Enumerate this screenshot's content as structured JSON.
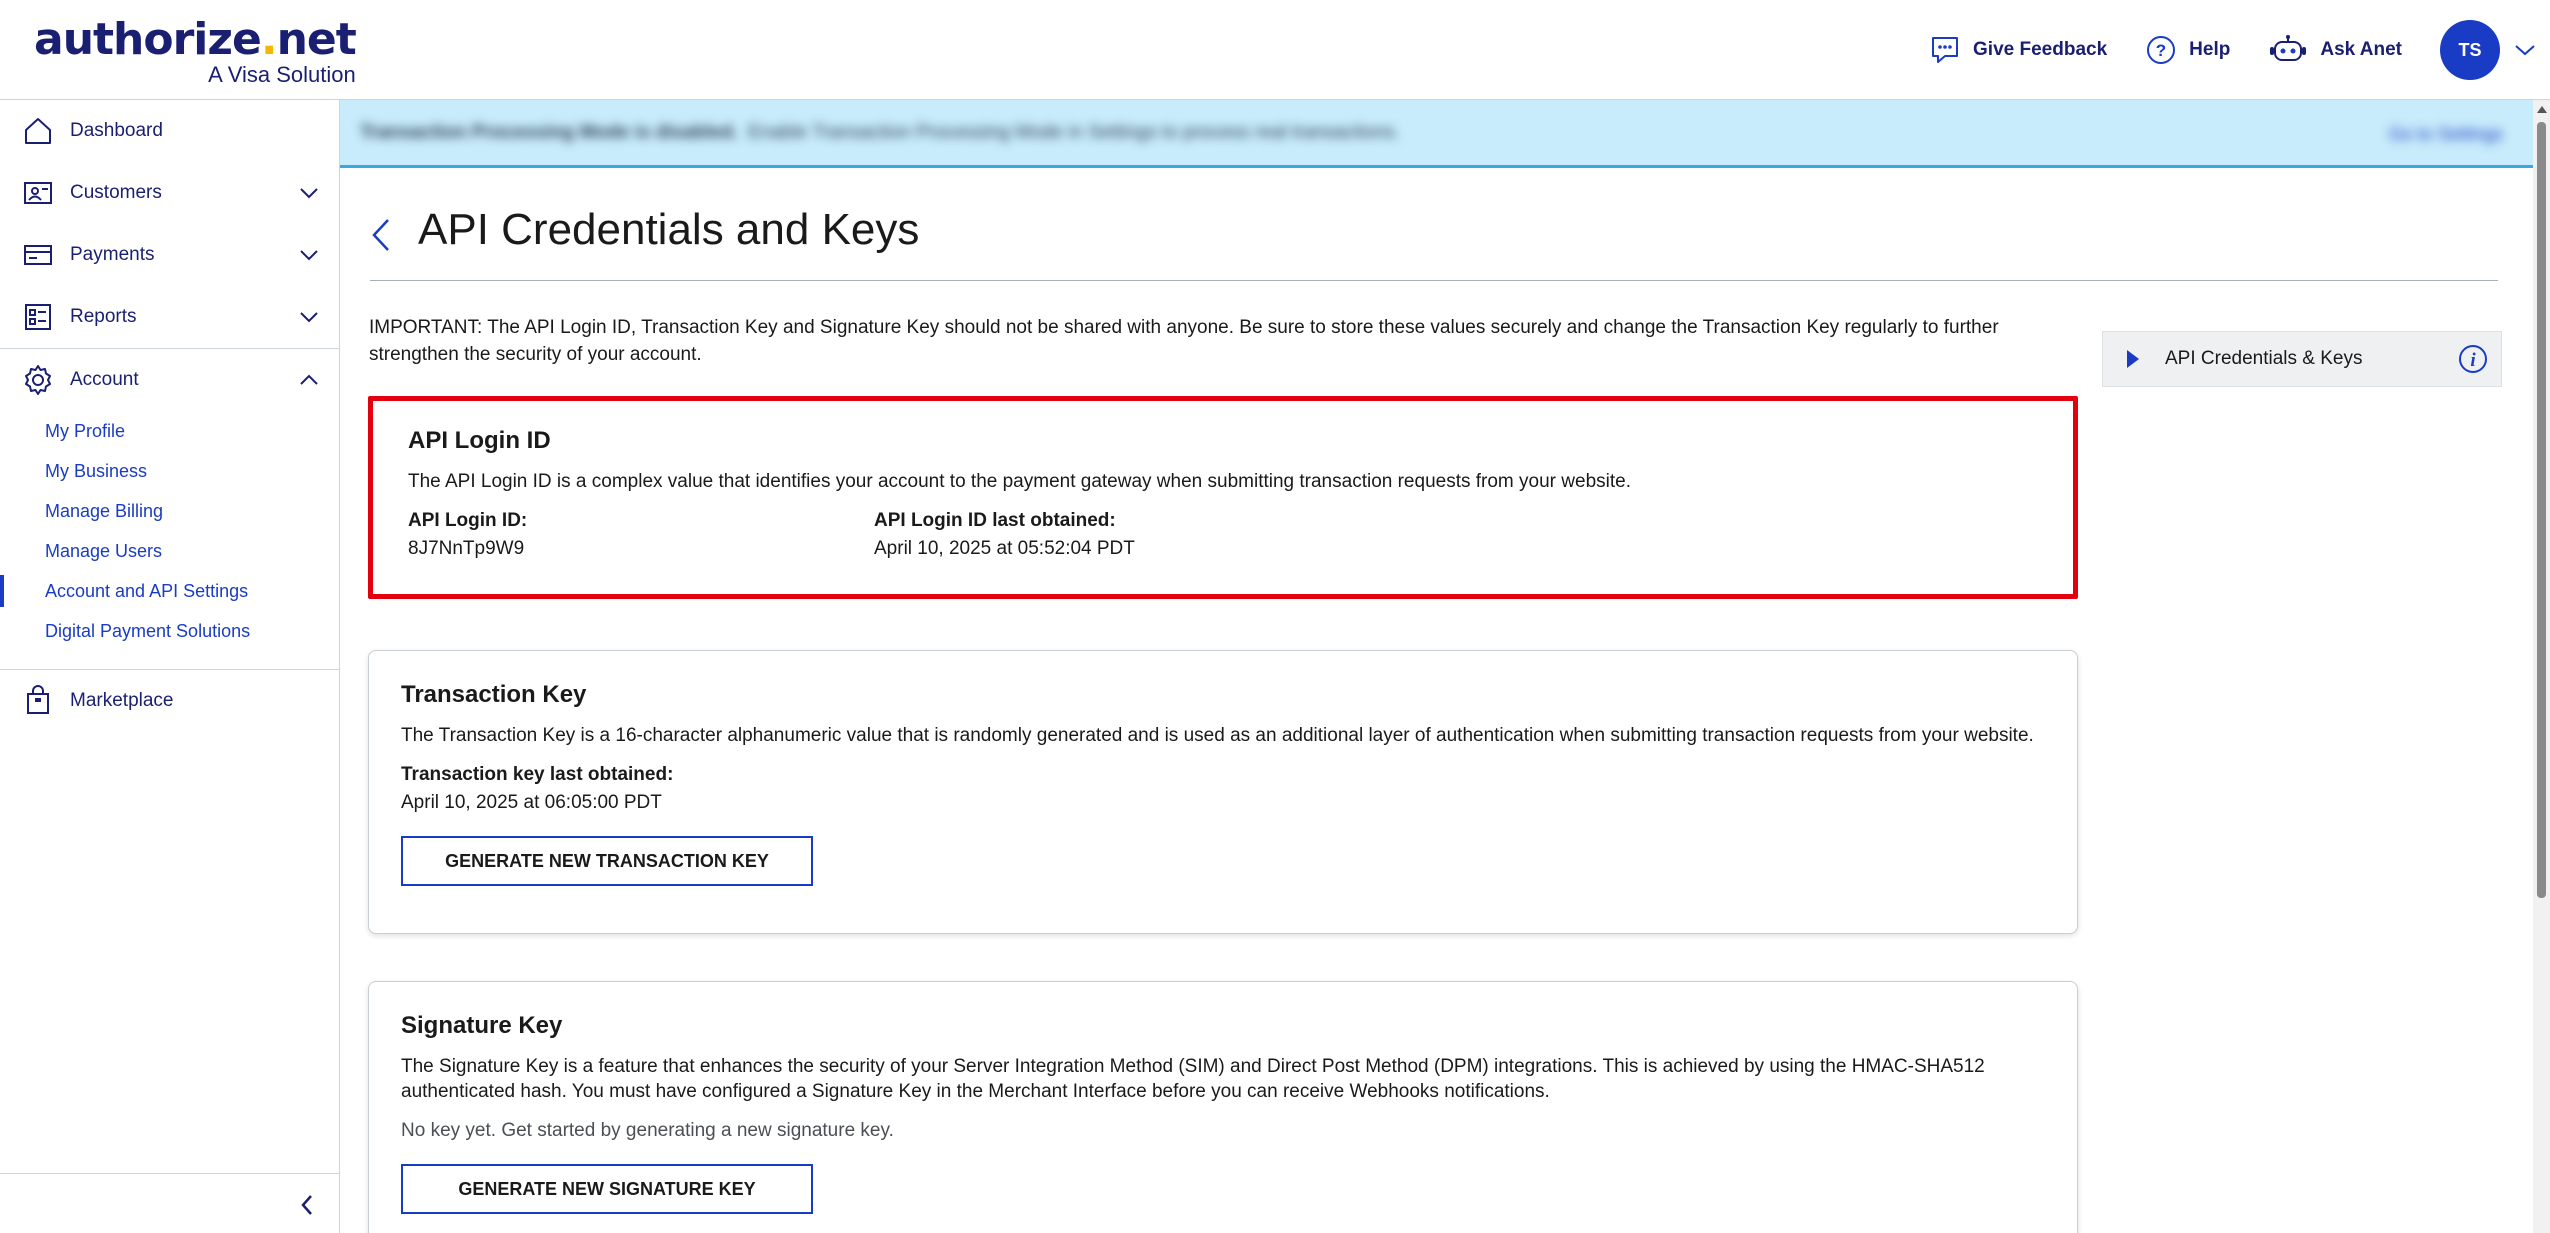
{
  "logo": {
    "main": "authorize",
    "dot": ".",
    "tld": "net",
    "sub": "A Visa Solution"
  },
  "header": {
    "feedback": "Give Feedback",
    "help": "Help",
    "ask": "Ask Anet",
    "avatar_initials": "TS"
  },
  "sidebar": {
    "dashboard": "Dashboard",
    "customers": "Customers",
    "payments": "Payments",
    "reports": "Reports",
    "account": "Account",
    "account_items": [
      "My Profile",
      "My Business",
      "Manage Billing",
      "Manage Users",
      "Account and API Settings",
      "Digital Payment Solutions"
    ],
    "marketplace": "Marketplace"
  },
  "banner": {
    "bold": "Transaction Processing Mode is disabled.",
    "text": "Enable Transaction Processing Mode in Settings to process real transactions.",
    "link": "Go to Settings"
  },
  "page": {
    "title": "API Credentials and Keys",
    "important": "IMPORTANT: The API Login ID, Transaction Key and Signature Key should not be shared with anyone. Be sure to store these values securely and change the Transaction Key regularly to further strengthen the security of your account."
  },
  "login_card": {
    "title": "API Login ID",
    "desc": "The API Login ID is a complex value that identifies your account to the payment gateway when submitting transaction requests from your website.",
    "id_label": "API Login ID:",
    "id_value": "8J7NnTp9W9",
    "obtained_label": "API Login ID last obtained:",
    "obtained_value": "April 10, 2025 at 05:52:04 PDT"
  },
  "transaction_card": {
    "title": "Transaction Key",
    "desc": "The Transaction Key is a 16-character alphanumeric value that is randomly generated and is used as an additional layer of authentication when submitting transaction requests from your website.",
    "obtained_label": "Transaction key last obtained:",
    "obtained_value": "April 10, 2025 at 06:05:00 PDT",
    "button": "GENERATE NEW TRANSACTION KEY"
  },
  "signature_card": {
    "title": "Signature Key",
    "desc": "The Signature Key is a feature that enhances the security of your Server Integration Method (SIM) and Direct Post Method (DPM) integrations. This is achieved by using the HMAC-SHA512 authenticated hash. You must have configured a Signature Key in the Merchant Interface before you can receive Webhooks notifications.",
    "status": "No key yet. Get started by generating a new signature key.",
    "button": "GENERATE NEW SIGNATURE KEY"
  },
  "side_panel": {
    "label": "API Credentials & Keys"
  },
  "colors": {
    "brand_navy": "#1a1f71",
    "link_blue": "#1a3cc4",
    "highlight_red": "#e3000f",
    "banner_bg": "#c8ecfb",
    "logo_dot": "#f7b600"
  }
}
